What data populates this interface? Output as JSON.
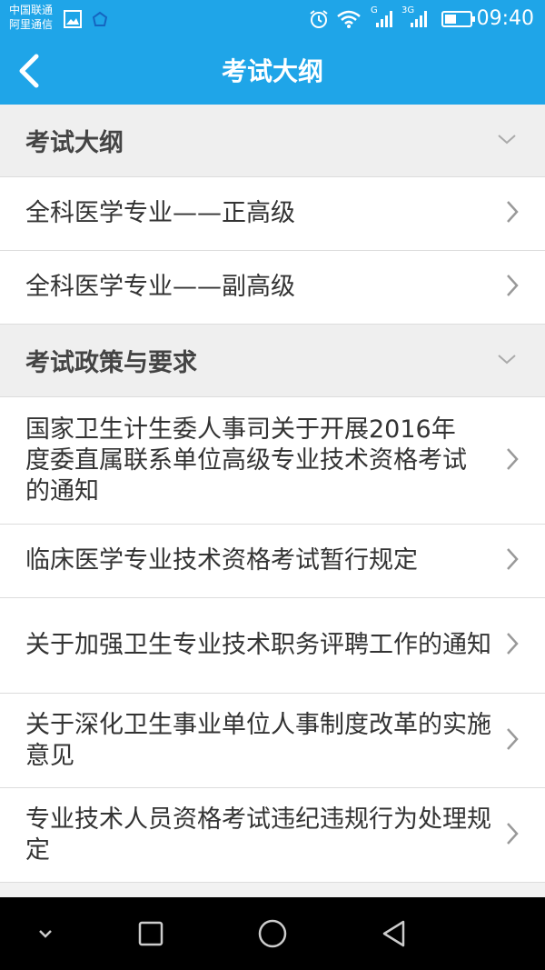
{
  "status_bar": {
    "carrier_line1": "中国联通",
    "carrier_line2": "阿里通信",
    "network_g": "G",
    "network_3g": "3G",
    "time": "09:40",
    "icons": [
      "image-icon",
      "app-icon",
      "alarm-icon",
      "wifi-icon",
      "signal-icon",
      "signal-3g-icon",
      "battery-icon"
    ]
  },
  "header": {
    "title": "考试大纲",
    "back_icon": "back-arrow-icon"
  },
  "sections": [
    {
      "label": "考试大纲",
      "items": [
        {
          "label": "全科医学专业——正高级"
        },
        {
          "label": "全科医学专业——副高级"
        }
      ]
    },
    {
      "label": "考试政策与要求",
      "items": [
        {
          "label": "国家卫生计生委人事司关于开展2016年度委直属联系单位高级专业技术资格考试的通知"
        },
        {
          "label": "临床医学专业技术资格考试暂行规定"
        },
        {
          "label": "关于加强卫生专业技术职务评聘工作的通知"
        },
        {
          "label": "关于深化卫生事业单位人事制度改革的实施意见"
        },
        {
          "label": "专业技术人员资格考试违纪违规行为处理规定"
        }
      ]
    }
  ],
  "nav_bar": {
    "icons": [
      "chevron-down-icon",
      "recents-square-icon",
      "home-circle-icon",
      "back-triangle-icon"
    ]
  },
  "colors": {
    "accent": "#1fa5e8",
    "section_bg": "#efefef",
    "divider": "#dcdcdc"
  }
}
